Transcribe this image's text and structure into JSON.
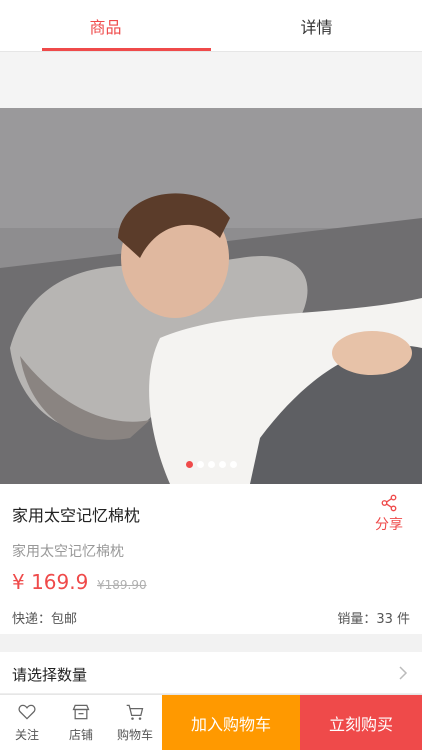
{
  "tabs": {
    "product": "商品",
    "details": "详情"
  },
  "product": {
    "title": "家用太空记忆棉枕",
    "subtitle": "家用太空记忆棉枕",
    "price": "¥ 169.9",
    "original_price": "¥189.90",
    "shipping": "快递：包邮",
    "sales": "销量：33 件"
  },
  "share_label": "分享",
  "carousel": {
    "count": 5,
    "active": 0
  },
  "quantity_prompt": "请选择数量",
  "bottom_bar": {
    "follow": "关注",
    "store": "店铺",
    "cart": "购物车",
    "add_to_cart": "加入购物车",
    "buy_now": "立刻购买"
  },
  "colors": {
    "accent": "#ef4a4a",
    "cart_button": "#ff9900"
  }
}
